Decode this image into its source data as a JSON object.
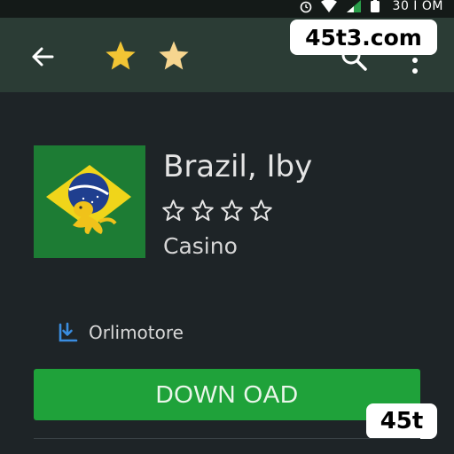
{
  "status_bar": {
    "time": "30 I OM",
    "icons": [
      "alarm-icon",
      "wifi-icon",
      "signal-icon",
      "battery-icon"
    ]
  },
  "app_bar": {
    "back_icon": "arrow-left-icon",
    "top_stars": [
      "star-icon",
      "star-icon"
    ],
    "search_icon": "search-icon",
    "more_icon": "more-vert-icon"
  },
  "watermarks": {
    "top": "45t3.com",
    "bottom": "45t"
  },
  "app": {
    "title": "Brazil, Iby",
    "rating_stars": 4,
    "category": "Casino",
    "publisher": "Orlimotore",
    "download_label": "DOWN OAD"
  },
  "colors": {
    "status_bar_bg": "#141a18",
    "app_bar_bg": "#2b3c35",
    "page_bg": "#1e2427",
    "star_yellow": "#f2c534",
    "download_green": "#1fa23a",
    "publisher_icon_blue": "#3a8de0"
  }
}
